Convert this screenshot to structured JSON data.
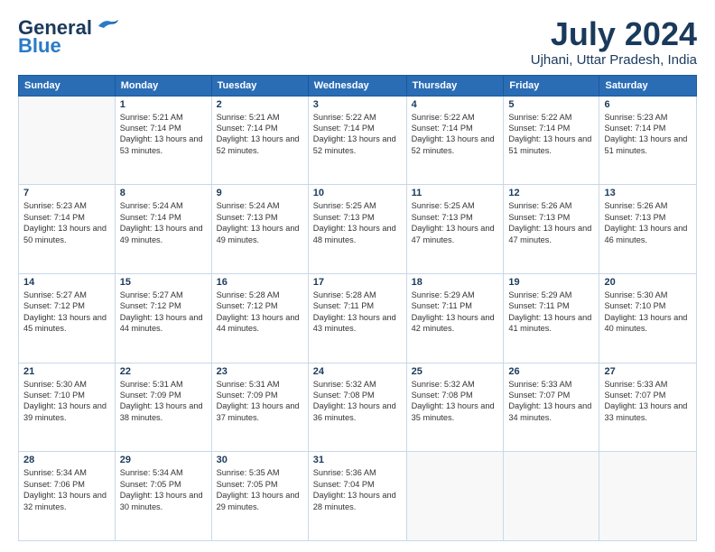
{
  "header": {
    "logo_line1": "General",
    "logo_line2": "Blue",
    "title": "July 2024",
    "subtitle": "Ujhani, Uttar Pradesh, India"
  },
  "days_of_week": [
    "Sunday",
    "Monday",
    "Tuesday",
    "Wednesday",
    "Thursday",
    "Friday",
    "Saturday"
  ],
  "weeks": [
    [
      {
        "day": "",
        "sunrise": "",
        "sunset": "",
        "daylight": ""
      },
      {
        "day": "1",
        "sunrise": "Sunrise: 5:21 AM",
        "sunset": "Sunset: 7:14 PM",
        "daylight": "Daylight: 13 hours and 53 minutes."
      },
      {
        "day": "2",
        "sunrise": "Sunrise: 5:21 AM",
        "sunset": "Sunset: 7:14 PM",
        "daylight": "Daylight: 13 hours and 52 minutes."
      },
      {
        "day": "3",
        "sunrise": "Sunrise: 5:22 AM",
        "sunset": "Sunset: 7:14 PM",
        "daylight": "Daylight: 13 hours and 52 minutes."
      },
      {
        "day": "4",
        "sunrise": "Sunrise: 5:22 AM",
        "sunset": "Sunset: 7:14 PM",
        "daylight": "Daylight: 13 hours and 52 minutes."
      },
      {
        "day": "5",
        "sunrise": "Sunrise: 5:22 AM",
        "sunset": "Sunset: 7:14 PM",
        "daylight": "Daylight: 13 hours and 51 minutes."
      },
      {
        "day": "6",
        "sunrise": "Sunrise: 5:23 AM",
        "sunset": "Sunset: 7:14 PM",
        "daylight": "Daylight: 13 hours and 51 minutes."
      }
    ],
    [
      {
        "day": "7",
        "sunrise": "Sunrise: 5:23 AM",
        "sunset": "Sunset: 7:14 PM",
        "daylight": "Daylight: 13 hours and 50 minutes."
      },
      {
        "day": "8",
        "sunrise": "Sunrise: 5:24 AM",
        "sunset": "Sunset: 7:14 PM",
        "daylight": "Daylight: 13 hours and 49 minutes."
      },
      {
        "day": "9",
        "sunrise": "Sunrise: 5:24 AM",
        "sunset": "Sunset: 7:13 PM",
        "daylight": "Daylight: 13 hours and 49 minutes."
      },
      {
        "day": "10",
        "sunrise": "Sunrise: 5:25 AM",
        "sunset": "Sunset: 7:13 PM",
        "daylight": "Daylight: 13 hours and 48 minutes."
      },
      {
        "day": "11",
        "sunrise": "Sunrise: 5:25 AM",
        "sunset": "Sunset: 7:13 PM",
        "daylight": "Daylight: 13 hours and 47 minutes."
      },
      {
        "day": "12",
        "sunrise": "Sunrise: 5:26 AM",
        "sunset": "Sunset: 7:13 PM",
        "daylight": "Daylight: 13 hours and 47 minutes."
      },
      {
        "day": "13",
        "sunrise": "Sunrise: 5:26 AM",
        "sunset": "Sunset: 7:13 PM",
        "daylight": "Daylight: 13 hours and 46 minutes."
      }
    ],
    [
      {
        "day": "14",
        "sunrise": "Sunrise: 5:27 AM",
        "sunset": "Sunset: 7:12 PM",
        "daylight": "Daylight: 13 hours and 45 minutes."
      },
      {
        "day": "15",
        "sunrise": "Sunrise: 5:27 AM",
        "sunset": "Sunset: 7:12 PM",
        "daylight": "Daylight: 13 hours and 44 minutes."
      },
      {
        "day": "16",
        "sunrise": "Sunrise: 5:28 AM",
        "sunset": "Sunset: 7:12 PM",
        "daylight": "Daylight: 13 hours and 44 minutes."
      },
      {
        "day": "17",
        "sunrise": "Sunrise: 5:28 AM",
        "sunset": "Sunset: 7:11 PM",
        "daylight": "Daylight: 13 hours and 43 minutes."
      },
      {
        "day": "18",
        "sunrise": "Sunrise: 5:29 AM",
        "sunset": "Sunset: 7:11 PM",
        "daylight": "Daylight: 13 hours and 42 minutes."
      },
      {
        "day": "19",
        "sunrise": "Sunrise: 5:29 AM",
        "sunset": "Sunset: 7:11 PM",
        "daylight": "Daylight: 13 hours and 41 minutes."
      },
      {
        "day": "20",
        "sunrise": "Sunrise: 5:30 AM",
        "sunset": "Sunset: 7:10 PM",
        "daylight": "Daylight: 13 hours and 40 minutes."
      }
    ],
    [
      {
        "day": "21",
        "sunrise": "Sunrise: 5:30 AM",
        "sunset": "Sunset: 7:10 PM",
        "daylight": "Daylight: 13 hours and 39 minutes."
      },
      {
        "day": "22",
        "sunrise": "Sunrise: 5:31 AM",
        "sunset": "Sunset: 7:09 PM",
        "daylight": "Daylight: 13 hours and 38 minutes."
      },
      {
        "day": "23",
        "sunrise": "Sunrise: 5:31 AM",
        "sunset": "Sunset: 7:09 PM",
        "daylight": "Daylight: 13 hours and 37 minutes."
      },
      {
        "day": "24",
        "sunrise": "Sunrise: 5:32 AM",
        "sunset": "Sunset: 7:08 PM",
        "daylight": "Daylight: 13 hours and 36 minutes."
      },
      {
        "day": "25",
        "sunrise": "Sunrise: 5:32 AM",
        "sunset": "Sunset: 7:08 PM",
        "daylight": "Daylight: 13 hours and 35 minutes."
      },
      {
        "day": "26",
        "sunrise": "Sunrise: 5:33 AM",
        "sunset": "Sunset: 7:07 PM",
        "daylight": "Daylight: 13 hours and 34 minutes."
      },
      {
        "day": "27",
        "sunrise": "Sunrise: 5:33 AM",
        "sunset": "Sunset: 7:07 PM",
        "daylight": "Daylight: 13 hours and 33 minutes."
      }
    ],
    [
      {
        "day": "28",
        "sunrise": "Sunrise: 5:34 AM",
        "sunset": "Sunset: 7:06 PM",
        "daylight": "Daylight: 13 hours and 32 minutes."
      },
      {
        "day": "29",
        "sunrise": "Sunrise: 5:34 AM",
        "sunset": "Sunset: 7:05 PM",
        "daylight": "Daylight: 13 hours and 30 minutes."
      },
      {
        "day": "30",
        "sunrise": "Sunrise: 5:35 AM",
        "sunset": "Sunset: 7:05 PM",
        "daylight": "Daylight: 13 hours and 29 minutes."
      },
      {
        "day": "31",
        "sunrise": "Sunrise: 5:36 AM",
        "sunset": "Sunset: 7:04 PM",
        "daylight": "Daylight: 13 hours and 28 minutes."
      },
      {
        "day": "",
        "sunrise": "",
        "sunset": "",
        "daylight": ""
      },
      {
        "day": "",
        "sunrise": "",
        "sunset": "",
        "daylight": ""
      },
      {
        "day": "",
        "sunrise": "",
        "sunset": "",
        "daylight": ""
      }
    ]
  ]
}
